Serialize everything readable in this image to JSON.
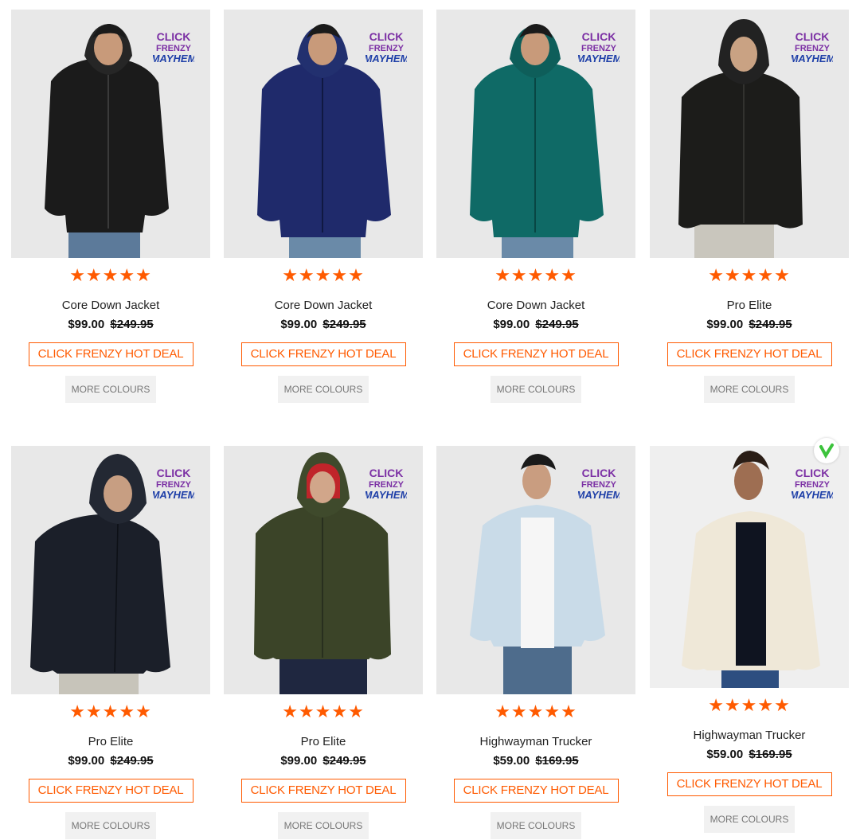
{
  "badge_text": [
    "CLICK",
    "FRENZY",
    "MAYHEM"
  ],
  "deal_label": "CLICK FRENZY HOT DEAL",
  "more_colours_label": "MORE COLOURS",
  "products": [
    {
      "name": "Core Down Jacket",
      "price": "$99.00",
      "was": "$249.95",
      "rating": 4.5,
      "jacket_color": "#1b1b1b"
    },
    {
      "name": "Core Down Jacket",
      "price": "$99.00",
      "was": "$249.95",
      "rating": 4.5,
      "jacket_color": "#1f2a6b"
    },
    {
      "name": "Core Down Jacket",
      "price": "$99.00",
      "was": "$249.95",
      "rating": 4.5,
      "jacket_color": "#0f6a66"
    },
    {
      "name": "Pro Elite",
      "price": "$99.00",
      "was": "$249.95",
      "rating": 5,
      "jacket_color": "#1c1c1a"
    },
    {
      "name": "Pro Elite",
      "price": "$99.00",
      "was": "$249.95",
      "rating": 5,
      "jacket_color": "#1b1f29"
    },
    {
      "name": "Pro Elite",
      "price": "$99.00",
      "was": "$249.95",
      "rating": 5,
      "jacket_color": "#3b4428"
    },
    {
      "name": "Highwayman Trucker",
      "price": "$59.00",
      "was": "$169.95",
      "rating": 4.5,
      "jacket_color": "#c9dbe8"
    },
    {
      "name": "Highwayman Trucker",
      "price": "$59.00",
      "was": "$169.95",
      "rating": 5,
      "jacket_color": "#efe8d8"
    }
  ],
  "colors": {
    "accent": "#ff5a00",
    "badge_purple": "#7b2fa4",
    "badge_blue": "#1e3fa8",
    "check_green": "#3cc33c"
  }
}
